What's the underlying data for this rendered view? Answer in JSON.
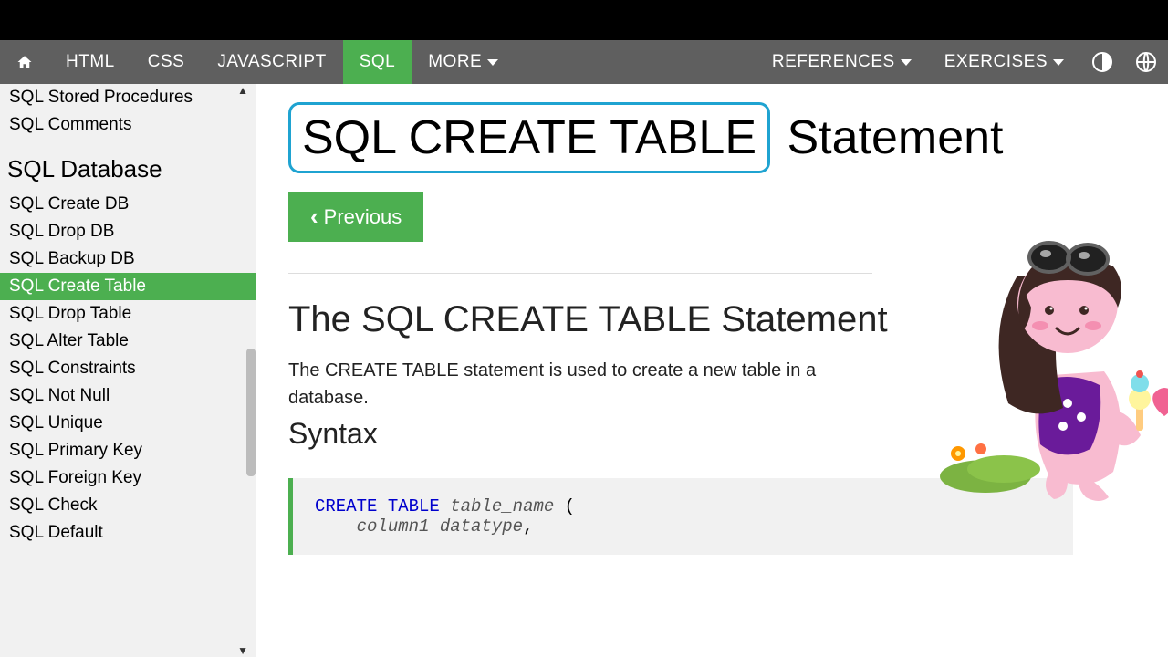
{
  "topnav": {
    "items": [
      "HTML",
      "CSS",
      "JAVASCRIPT",
      "SQL",
      "MORE"
    ],
    "active_index": 3,
    "right_items": [
      "REFERENCES",
      "EXERCISES"
    ]
  },
  "sidebar": {
    "top_items": [
      "SQL Stored Procedures",
      "SQL Comments"
    ],
    "section_heading": "SQL Database",
    "section_items": [
      "SQL Create DB",
      "SQL Drop DB",
      "SQL Backup DB",
      "SQL Create Table",
      "SQL Drop Table",
      "SQL Alter Table",
      "SQL Constraints",
      "SQL Not Null",
      "SQL Unique",
      "SQL Primary Key",
      "SQL Foreign Key",
      "SQL Check",
      "SQL Default"
    ],
    "active_index": 3
  },
  "main": {
    "title_boxed": "SQL CREATE TABLE",
    "title_rest": " Statement",
    "prev_label": "Previous",
    "section_heading": "The SQL CREATE TABLE Statement",
    "paragraph": "The CREATE TABLE statement is used to create a new table in a database.",
    "syntax_heading": "Syntax",
    "code": {
      "kw1": "CREATE",
      "kw2": "TABLE",
      "name": "table_name",
      "open": " (",
      "line2_col": "column1",
      "line2_type": "datatype",
      "comma": ","
    }
  }
}
